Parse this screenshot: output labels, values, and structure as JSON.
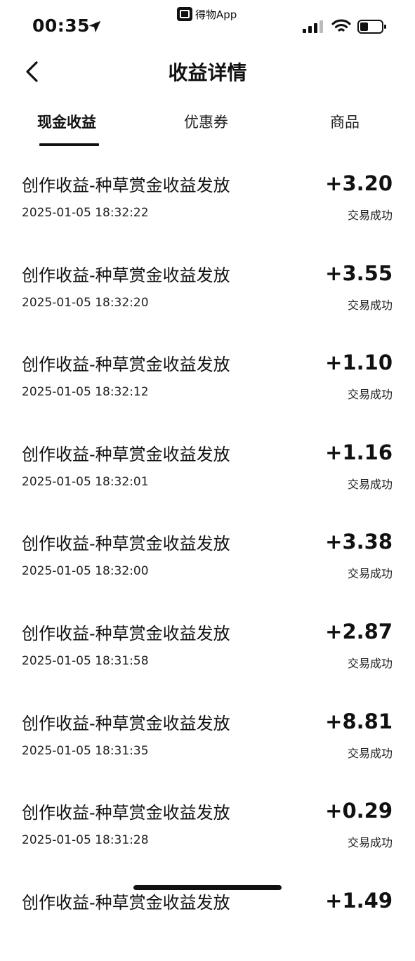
{
  "status_bar": {
    "time": "00:35",
    "app_name": "得物App"
  },
  "header": {
    "title": "收益详情"
  },
  "tabs": [
    {
      "label": "现金收益",
      "active": true
    },
    {
      "label": "优惠券",
      "active": false
    },
    {
      "label": "商品",
      "active": false
    }
  ],
  "transactions": [
    {
      "title": "创作收益-种草赏金收益发放",
      "time": "2025-01-05 18:32:22",
      "amount": "+3.20",
      "status": "交易成功"
    },
    {
      "title": "创作收益-种草赏金收益发放",
      "time": "2025-01-05 18:32:20",
      "amount": "+3.55",
      "status": "交易成功"
    },
    {
      "title": "创作收益-种草赏金收益发放",
      "time": "2025-01-05 18:32:12",
      "amount": "+1.10",
      "status": "交易成功"
    },
    {
      "title": "创作收益-种草赏金收益发放",
      "time": "2025-01-05 18:32:01",
      "amount": "+1.16",
      "status": "交易成功"
    },
    {
      "title": "创作收益-种草赏金收益发放",
      "time": "2025-01-05 18:32:00",
      "amount": "+3.38",
      "status": "交易成功"
    },
    {
      "title": "创作收益-种草赏金收益发放",
      "time": "2025-01-05 18:31:58",
      "amount": "+2.87",
      "status": "交易成功"
    },
    {
      "title": "创作收益-种草赏金收益发放",
      "time": "2025-01-05 18:31:35",
      "amount": "+8.81",
      "status": "交易成功"
    },
    {
      "title": "创作收益-种草赏金收益发放",
      "time": "2025-01-05 18:31:28",
      "amount": "+0.29",
      "status": "交易成功"
    },
    {
      "title": "创作收益-种草赏金收益发放",
      "time": "",
      "amount": "+1.49",
      "status": ""
    }
  ],
  "icons": {
    "back": "chevron-left-icon",
    "location": "location-arrow-icon",
    "signal": "cellular-signal-icon",
    "wifi": "wifi-icon",
    "battery": "battery-icon"
  }
}
